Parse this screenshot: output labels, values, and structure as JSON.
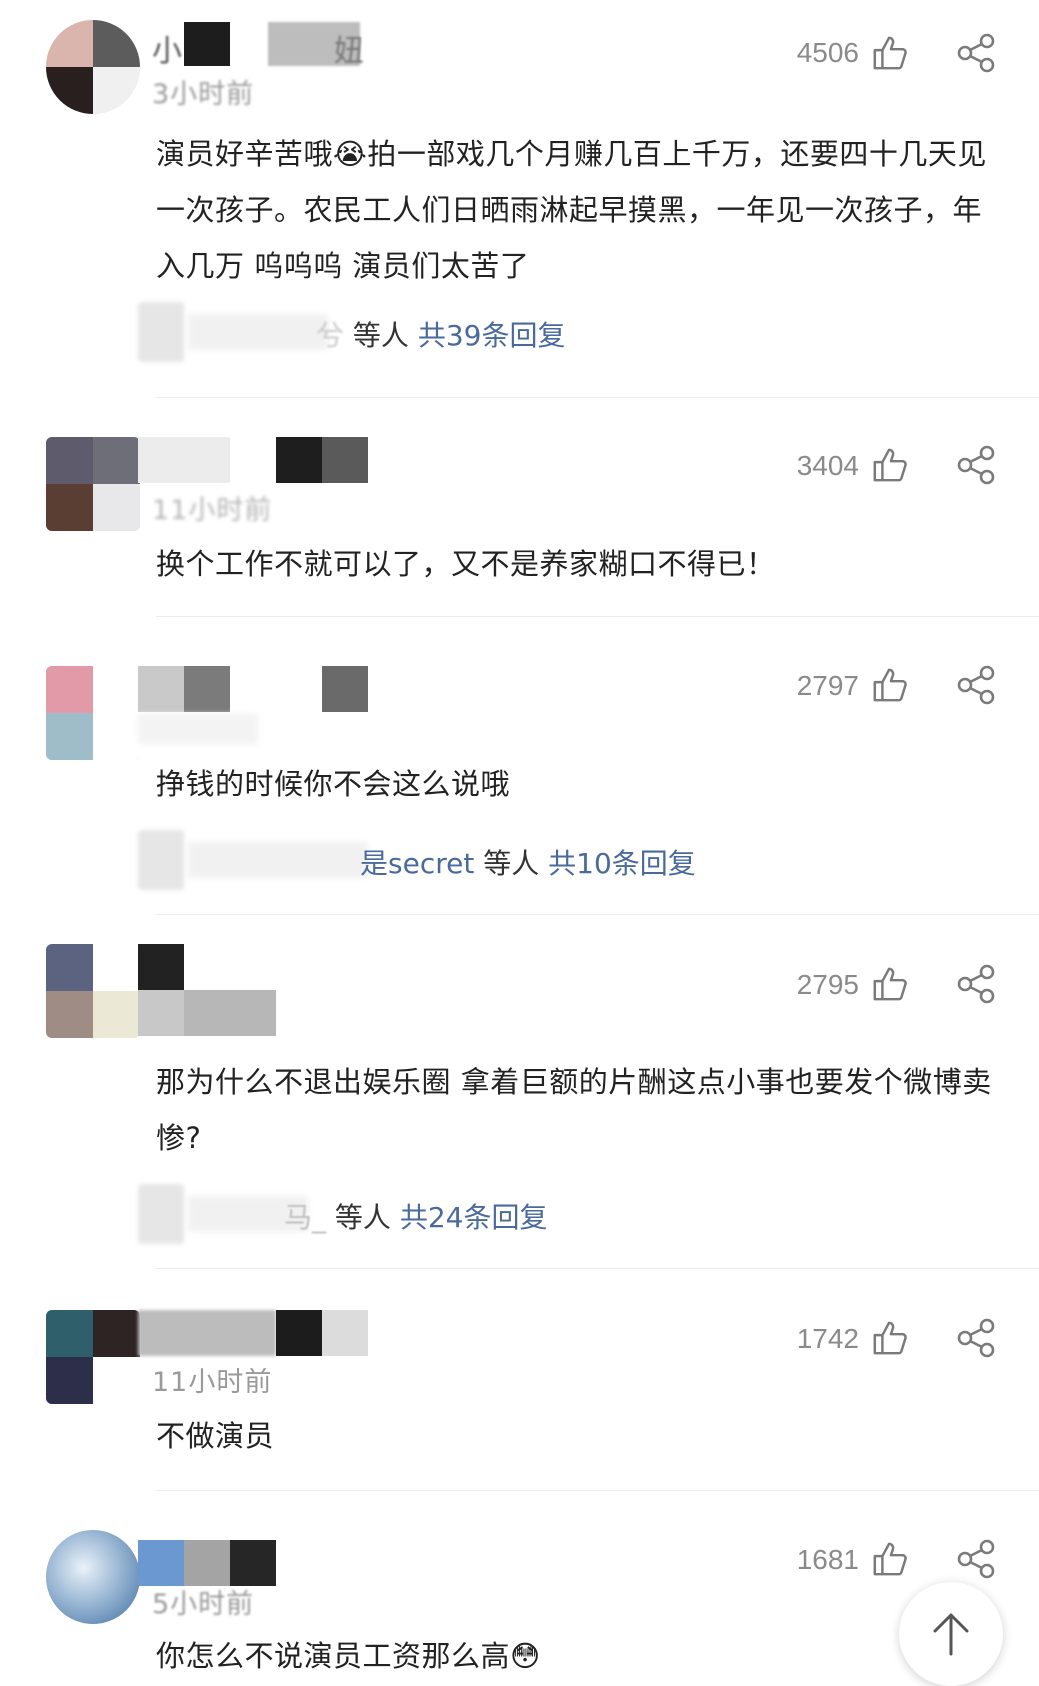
{
  "comments": [
    {
      "name_fragment_a": "小",
      "name_fragment_b": "妞",
      "time": "3小时前",
      "likes": "4506",
      "text": "演员好辛苦哦😭拍一部戏几个月赚几百上千万，还要四十几天见一次孩子。农民工人们日晒雨淋起早摸黑，一年见一次孩子，年入几万 呜呜呜 演员们太苦了",
      "reply_name_tail": "兮",
      "reply_suffix": "等人",
      "reply_total": "共39条回复"
    },
    {
      "time": "11小时前",
      "likes": "3404",
      "text": "换个工作不就可以了，又不是养家糊口不得已！"
    },
    {
      "likes": "2797",
      "text": "挣钱的时候你不会这么说哦",
      "reply_name_tail": "是secret",
      "reply_suffix": "等人",
      "reply_total": "共10条回复"
    },
    {
      "likes": "2795",
      "text": "那为什么不退出娱乐圈 拿着巨额的片酬这点小事也要发个微博卖惨?",
      "reply_name_tail": "马_",
      "reply_suffix": "等人",
      "reply_total": "共24条回复"
    },
    {
      "time": "11小时前",
      "likes": "1742",
      "text": "不做演员"
    },
    {
      "time": "5小时前",
      "likes": "1681",
      "text": "你怎么不说演员工资那么高😳"
    }
  ],
  "icons": {
    "like": "thumbs-up-icon",
    "share": "share-icon",
    "scroll_top": "arrow-up-icon"
  },
  "colors": {
    "link": "#4a6a9c",
    "meta": "#9a9a9a",
    "text": "#222222"
  }
}
